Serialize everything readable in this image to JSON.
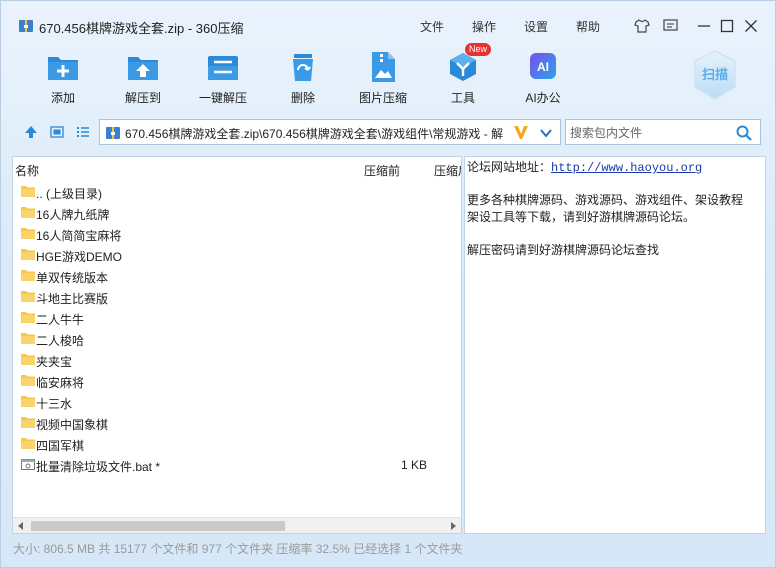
{
  "window": {
    "title": "670.456棋牌游戏全套.zip - 360压缩",
    "menus": [
      "文件",
      "操作",
      "设置",
      "帮助"
    ]
  },
  "toolbar": {
    "items": [
      {
        "label": "添加",
        "icon": "add-icon"
      },
      {
        "label": "解压到",
        "icon": "extract-to-icon"
      },
      {
        "label": "一键解压",
        "icon": "one-click-extract-icon"
      },
      {
        "label": "删除",
        "icon": "delete-icon"
      },
      {
        "label": "图片压缩",
        "icon": "image-compress-icon"
      },
      {
        "label": "工具",
        "icon": "tools-icon"
      },
      {
        "label": "AI办公",
        "icon": "ai-office-icon"
      }
    ],
    "new_badge": "New",
    "ai_icon_text": "AI",
    "scan_label": "扫描"
  },
  "address": {
    "path": "670.456棋牌游戏全套.zip\\670.456棋牌游戏全套\\游戏组件\\常规游戏 - 解"
  },
  "search": {
    "placeholder": "搜索包内文件"
  },
  "filelist": {
    "columns": [
      "名称",
      "压缩前",
      "压缩后"
    ],
    "rows": [
      {
        "name": ".. (上级目录)",
        "type": "folder",
        "size": ""
      },
      {
        "name": "16人牌九纸牌",
        "type": "folder",
        "size": ""
      },
      {
        "name": "16人简简宝麻将",
        "type": "folder",
        "size": ""
      },
      {
        "name": "HGE游戏DEMO",
        "type": "folder",
        "size": ""
      },
      {
        "name": "单双传统版本",
        "type": "folder",
        "size": ""
      },
      {
        "name": "斗地主比赛版",
        "type": "folder",
        "size": ""
      },
      {
        "name": "二人牛牛",
        "type": "folder",
        "size": ""
      },
      {
        "name": "二人梭哈",
        "type": "folder",
        "size": ""
      },
      {
        "name": "夹夹宝",
        "type": "folder",
        "size": ""
      },
      {
        "name": "临安麻将",
        "type": "folder",
        "size": ""
      },
      {
        "name": "十三水",
        "type": "folder",
        "size": ""
      },
      {
        "name": "视频中国象棋",
        "type": "folder",
        "size": ""
      },
      {
        "name": "四国军棋",
        "type": "folder",
        "size": ""
      },
      {
        "name": "批量清除垃圾文件.bat *",
        "type": "file",
        "size": "1 KB"
      }
    ]
  },
  "info": {
    "forum_label": "论坛网站地址：",
    "forum_url": "http://www.haoyou.org",
    "line2a": "更多各种棋牌源码、游戏源码、游戏组件、架设教程",
    "line2b": "架设工具等下载，请到好游棋牌源码论坛。",
    "line3": "解压密码请到好游棋牌源码论坛查找"
  },
  "statusbar": {
    "text": "大小: 806.5 MB 共 15177 个文件和 977 个文件夹 压缩率 32.5% 已经选择 1 个文件夹"
  },
  "colors": {
    "accent": "#2a8ad8",
    "folder": "#f7c64a",
    "badge": "#e8322f"
  }
}
